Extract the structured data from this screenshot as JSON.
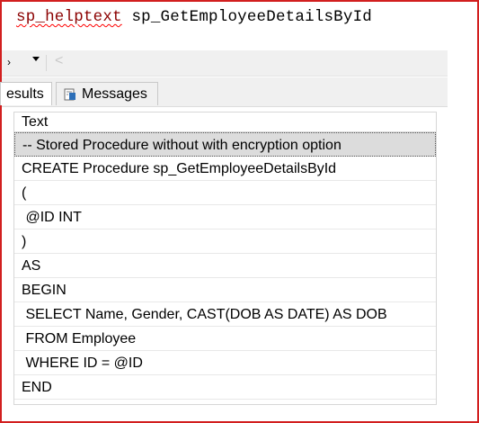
{
  "query": {
    "keyword": "sp_helptext",
    "object": "sp_GetEmployeeDetailsById"
  },
  "toolbar": {
    "dropdown_label": "›",
    "back_glyph": "<"
  },
  "tabs": {
    "results_label": "esults",
    "messages_label": "Messages"
  },
  "grid": {
    "header": "Text",
    "rows": [
      "-- Stored Procedure without with encryption option",
      "CREATE Procedure sp_GetEmployeeDetailsById",
      "(",
      " @ID INT",
      ")",
      "AS",
      "BEGIN",
      " SELECT Name, Gender, CAST(DOB AS DATE) AS DOB",
      " FROM Employee",
      " WHERE ID = @ID",
      "END"
    ]
  },
  "colors": {
    "frame": "#d21f1f",
    "keyword": "#8b0000",
    "selected_row": "#dcdcdc"
  }
}
